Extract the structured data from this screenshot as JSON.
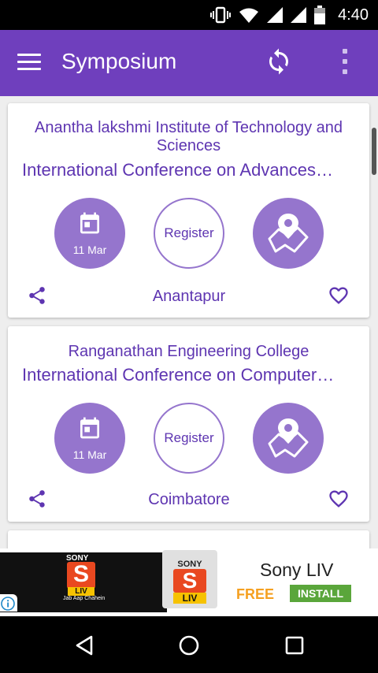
{
  "status_bar": {
    "time": "4:40"
  },
  "app_bar": {
    "title": "Symposium"
  },
  "events": [
    {
      "college": "Anantha lakshmi Institute of Technology and Sciences",
      "conference": "International Conference on Advances…",
      "date": "11 Mar",
      "register_label": "Register",
      "city": "Anantapur"
    },
    {
      "college": "Ranganathan Engineering College",
      "conference": "International Conference on Computer…",
      "date": "11 Mar",
      "register_label": "Register",
      "city": "Coimbatore"
    }
  ],
  "ad": {
    "banner_brand": "SONY",
    "banner_logo_text": "LIV",
    "banner_tagline": "Jab Aap Chahein",
    "logo_brand": "SONY",
    "logo_text": "LIV",
    "app_name": "Sony LIV",
    "price": "FREE",
    "install_label": "INSTALL"
  },
  "colors": {
    "primary": "#6f3fbd",
    "accent": "#5e35b1",
    "circle": "#9575cd",
    "install": "#5aa63b",
    "free": "#f5a020"
  },
  "icons": [
    "vibrate-icon",
    "wifi-icon",
    "signal-icon",
    "battery-icon",
    "menu-icon",
    "refresh-icon",
    "more-vert-icon",
    "calendar-icon",
    "map-location-icon",
    "share-icon",
    "heart-icon",
    "info-icon",
    "back-icon",
    "home-icon",
    "recents-icon"
  ]
}
